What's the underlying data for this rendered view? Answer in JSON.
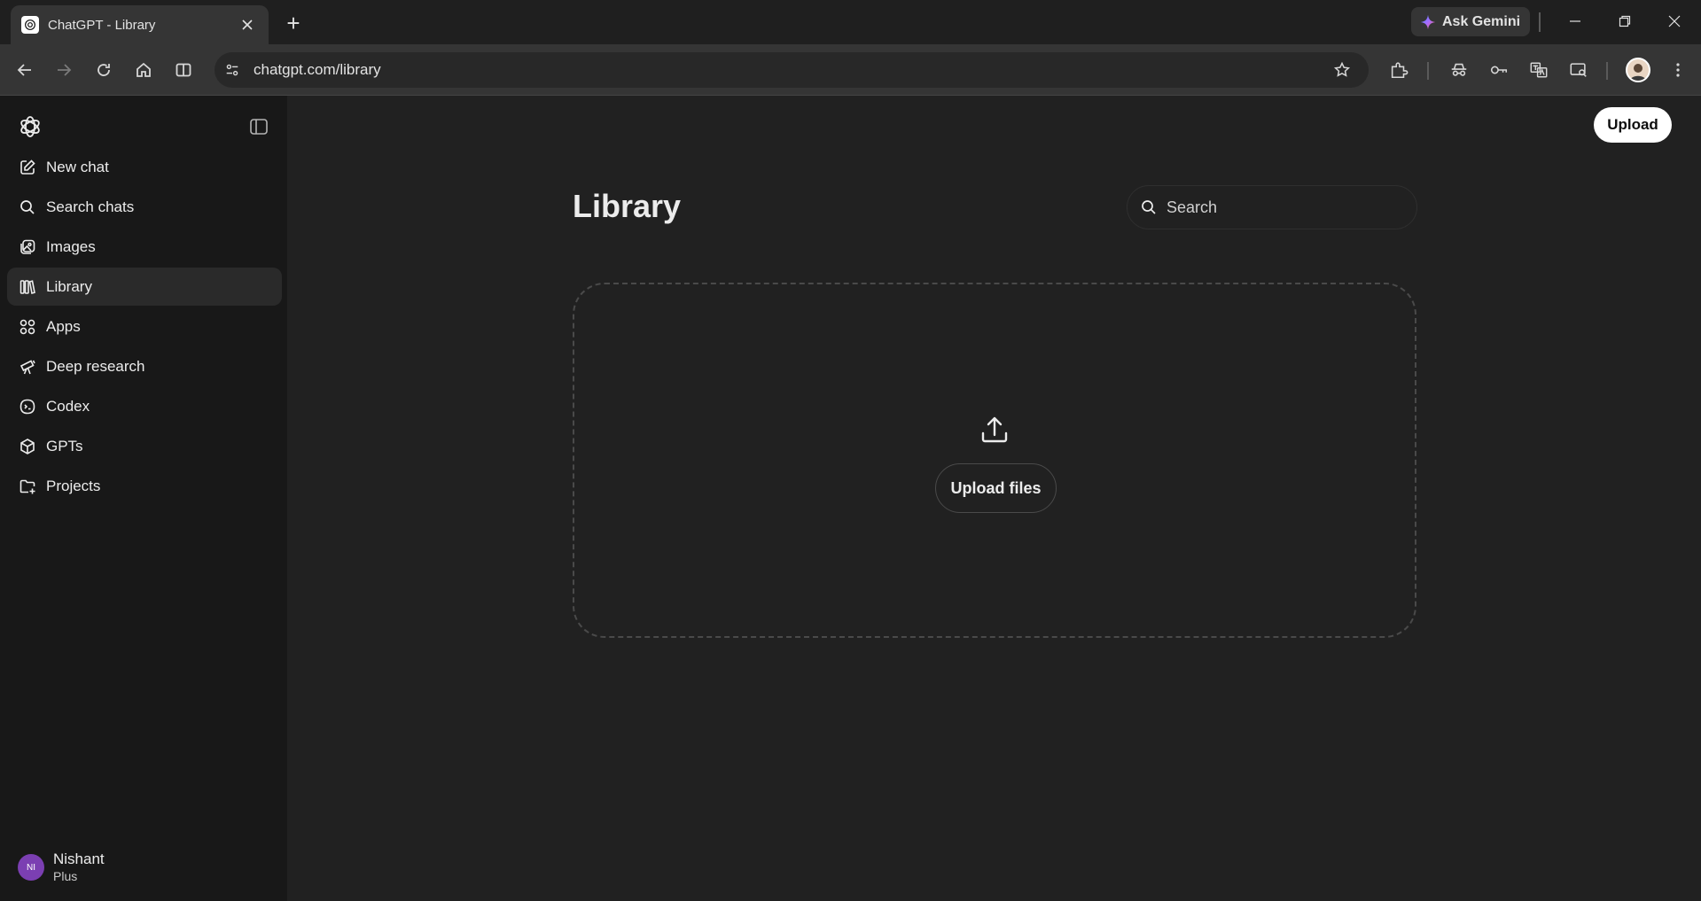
{
  "browser": {
    "tab_title": "ChatGPT - Library",
    "new_tab_symbol": "+",
    "ask_gemini_label": "Ask Gemini",
    "url": "chatgpt.com/library"
  },
  "sidebar": {
    "items": [
      {
        "label": "New chat",
        "icon": "edit-icon"
      },
      {
        "label": "Search chats",
        "icon": "search-icon"
      },
      {
        "label": "Images",
        "icon": "images-icon"
      },
      {
        "label": "Library",
        "icon": "library-icon",
        "active": true
      },
      {
        "label": "Apps",
        "icon": "apps-icon"
      },
      {
        "label": "Deep research",
        "icon": "telescope-icon"
      },
      {
        "label": "Codex",
        "icon": "codex-icon"
      },
      {
        "label": "GPTs",
        "icon": "cube-icon"
      },
      {
        "label": "Projects",
        "icon": "folder-plus-icon"
      }
    ],
    "user": {
      "initials": "NI",
      "name": "Nishant",
      "plan": "Plus",
      "avatar_color": "#7b3fb2"
    }
  },
  "main": {
    "upload_button_label": "Upload",
    "title": "Library",
    "search_placeholder": "Search",
    "dropzone_button_label": "Upload files"
  },
  "colors": {
    "background": "#212121",
    "sidebar": "#181818",
    "accent_button": "#ffffff"
  }
}
